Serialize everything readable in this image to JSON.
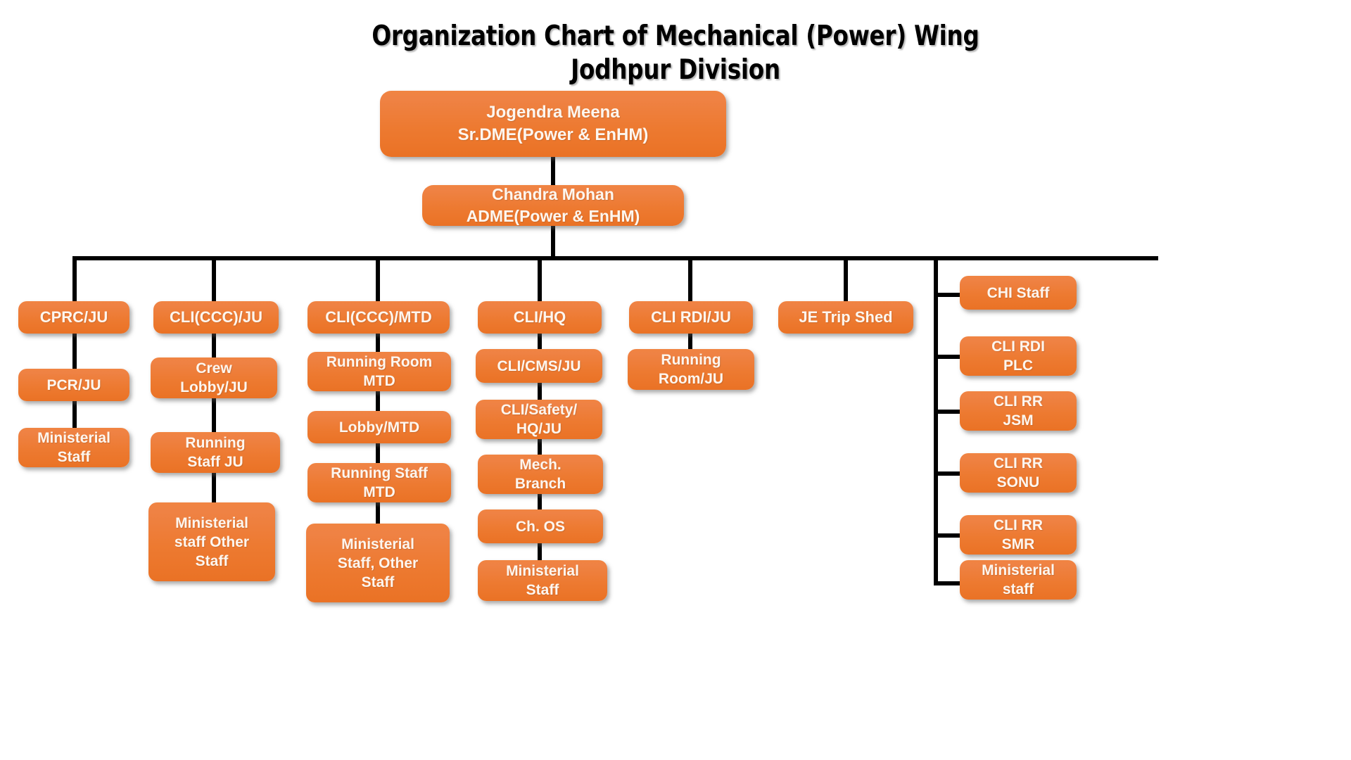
{
  "chart_data": {
    "type": "diagram",
    "title": "Organization Chart of Mechanical (Power) Wing\nJodhpur Division",
    "title_line1": "Organization Chart of Mechanical (Power) Wing",
    "title_line2": "Jodhpur Division",
    "accent_color": "#ed7a31",
    "line_color": "#000000",
    "text_color": "#fdf6ef",
    "nodes": {
      "root": "Jogendra Meena\nSr.DME(Power & EnHM)",
      "second": "Chandra Mohan\nADME(Power & EnHM)",
      "branch_cprc": "CPRC/JU",
      "branch_cli_ccc_ju": "CLI(CCC)/JU",
      "branch_cli_ccc_mtd": "CLI(CCC)/MTD",
      "branch_cli_hq": "CLI/HQ",
      "branch_cli_rdi_ju": "CLI RDI/JU",
      "branch_je_trip_shed": "JE Trip Shed",
      "cprc_1": "PCR/JU",
      "cprc_2": "Ministerial\nStaff",
      "cccju_1": "Crew\nLobby/JU",
      "cccju_2": "Running\nStaff JU",
      "cccju_3": "Ministerial\nstaff Other\nStaff",
      "cccmtd_1": "Running Room\nMTD",
      "cccmtd_2": "Lobby/MTD",
      "cccmtd_3": "Running Staff\nMTD",
      "cccmtd_4": "Ministerial\nStaff, Other\nStaff",
      "hq_1": "CLI/CMS/JU",
      "hq_2": "CLI/Safety/\nHQ/JU",
      "hq_3": "Mech.\nBranch",
      "hq_4": "Ch. OS",
      "hq_5": "Ministerial\nStaff",
      "rdi_1": "Running\nRoom/JU",
      "right_1": "CHI Staff",
      "right_2": "CLI RDI\nPLC",
      "right_3": "CLI RR\nJSM",
      "right_4": "CLI RR\nSONU",
      "right_5": "CLI RR\nSMR",
      "right_6": "Ministerial\nstaff"
    }
  }
}
